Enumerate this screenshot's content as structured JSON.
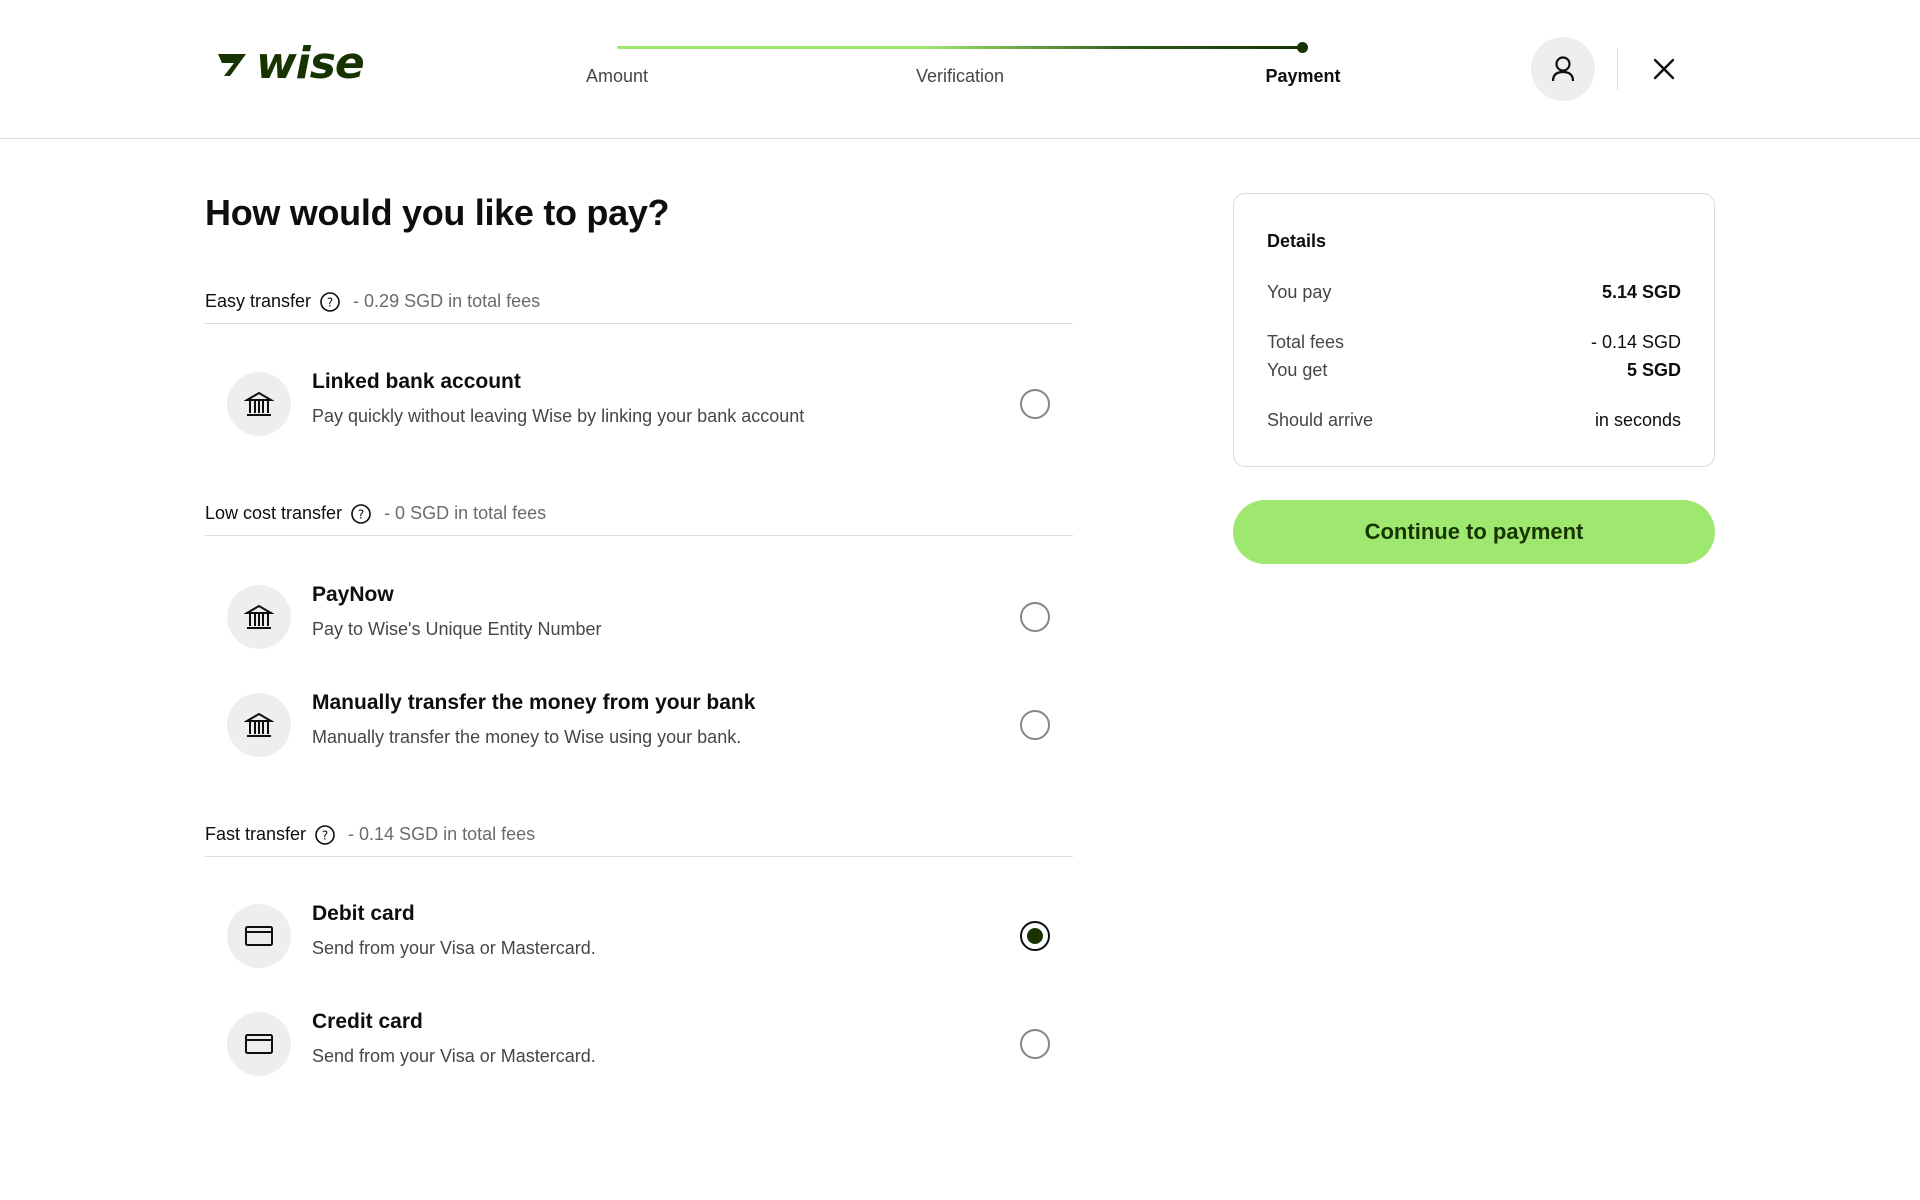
{
  "brand": {
    "name": "wise",
    "accent": "#9fe870",
    "dark": "#163300"
  },
  "stepper": {
    "steps": [
      {
        "label": "Amount",
        "state": "done"
      },
      {
        "label": "Verification",
        "state": "done"
      },
      {
        "label": "Payment",
        "state": "current"
      }
    ]
  },
  "header": {
    "account_icon": "person-icon",
    "close_icon": "close-icon"
  },
  "main": {
    "title": "How would you like to pay?",
    "sections": [
      {
        "name": "Easy transfer",
        "fee": "- 0.29 SGD in total fees",
        "options": [
          {
            "icon": "bank-icon",
            "title": "Linked bank account",
            "desc": "Pay quickly without leaving Wise by linking your bank account",
            "selected": false
          }
        ]
      },
      {
        "name": "Low cost transfer",
        "fee": "- 0 SGD in total fees",
        "options": [
          {
            "icon": "bank-icon",
            "title": "PayNow",
            "desc": "Pay to Wise's Unique Entity Number",
            "selected": false
          },
          {
            "icon": "bank-icon",
            "title": "Manually transfer the money from your bank",
            "desc": "Manually transfer the money to Wise using your bank.",
            "selected": false
          }
        ]
      },
      {
        "name": "Fast transfer",
        "fee": "- 0.14 SGD in total fees",
        "options": [
          {
            "icon": "card-icon",
            "title": "Debit card",
            "desc": "Send from your Visa or Mastercard.",
            "selected": true
          },
          {
            "icon": "card-icon",
            "title": "Credit card",
            "desc": "Send from your Visa or Mastercard.",
            "selected": false
          }
        ]
      }
    ]
  },
  "details": {
    "title": "Details",
    "you_pay_label": "You pay",
    "you_pay_value": "5.14 SGD",
    "fees_label": "Total fees",
    "fees_value": "- 0.14 SGD",
    "you_get_label": "You get",
    "you_get_value": "5 SGD",
    "arrive_label": "Should arrive",
    "arrive_value": "in seconds"
  },
  "continue_label": "Continue to payment"
}
